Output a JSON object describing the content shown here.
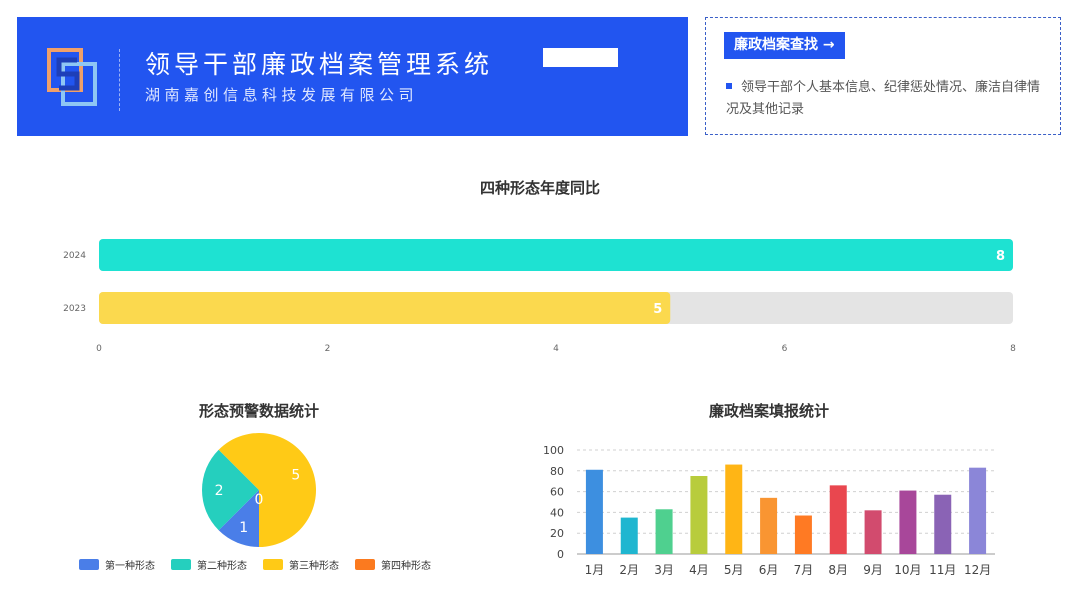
{
  "header": {
    "title": "领导干部廉政档案管理系统",
    "company": "湖南嘉创信息科技发展有限公司"
  },
  "search_panel": {
    "button_label": "廉政档案查找 →",
    "description": "领导干部个人基本信息、纪律惩处情况、廉洁自律情况及其他记录"
  },
  "colors": {
    "brand_blue": "#2255f0",
    "teal": "#1ee2d2",
    "yellow": "#fbd94e",
    "track": "#e4e4e4"
  },
  "charts": {
    "yoy_title": "四种形态年度同比",
    "pie_title": "形态预警数据统计",
    "monthly_title": "廉政档案填报统计"
  },
  "chart_data": [
    {
      "type": "bar",
      "orientation": "horizontal",
      "title": "四种形态年度同比",
      "categories": [
        "2024",
        "2023"
      ],
      "values": [
        8,
        5
      ],
      "colors": [
        "#1ee2d2",
        "#fbd94e"
      ],
      "xlim": [
        0,
        8
      ],
      "xticks": [
        "0",
        "2",
        "4",
        "6",
        "8"
      ],
      "grid": false
    },
    {
      "type": "pie",
      "title": "形态预警数据统计",
      "slices": [
        {
          "label": "第一种形态",
          "value": 1,
          "color": "#4a7ee8"
        },
        {
          "label": "第二种形态",
          "value": 2,
          "color": "#25cfbe"
        },
        {
          "label": "第三种形态",
          "value": 5,
          "color": "#ffca16"
        },
        {
          "label": "第四种形态",
          "value": 0,
          "color": "#fb7a1f"
        }
      ],
      "legend_position": "bottom"
    },
    {
      "type": "bar",
      "title": "廉政档案填报统计",
      "categories": [
        "1月",
        "2月",
        "3月",
        "4月",
        "5月",
        "6月",
        "7月",
        "8月",
        "9月",
        "10月",
        "11月",
        "12月"
      ],
      "values": [
        81,
        35,
        43,
        75,
        86,
        54,
        37,
        66,
        42,
        61,
        57,
        83
      ],
      "colors": [
        "#3d8fe0",
        "#1fb6d0",
        "#4fd08f",
        "#b8cc3c",
        "#ffb515",
        "#f99532",
        "#ff7a23",
        "#e9474f",
        "#d24b6e",
        "#a8479a",
        "#8a63b5",
        "#8b86d8"
      ],
      "ylim": [
        0,
        100
      ],
      "yticks": [
        "0",
        "20",
        "40",
        "60",
        "80",
        "100"
      ],
      "grid": true
    }
  ]
}
